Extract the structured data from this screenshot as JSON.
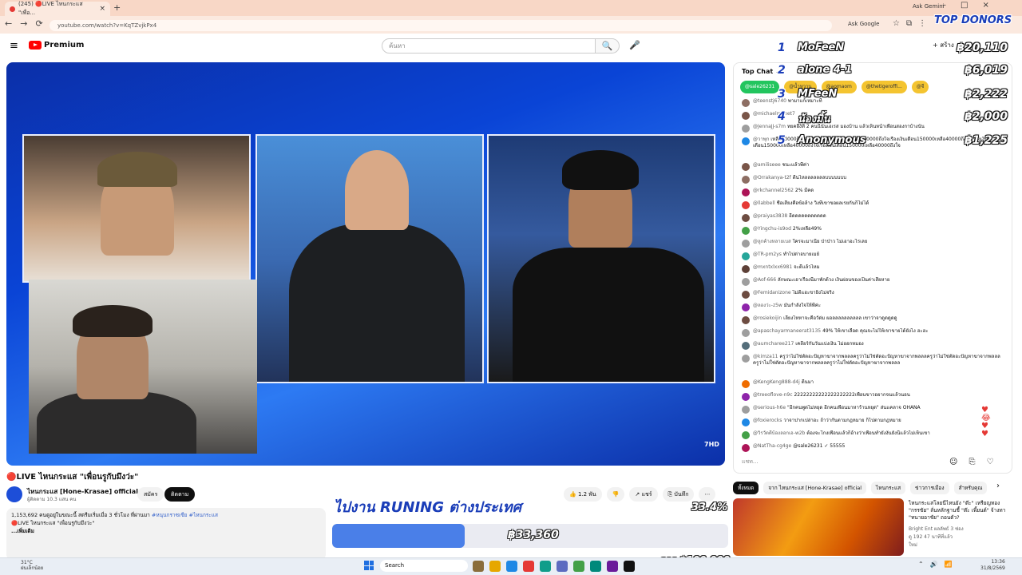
{
  "browser": {
    "tab_title": "(245) 🔴LIVE ไหนกระแส \"เพื่อ...",
    "tab_close": "×",
    "new_tab": "+",
    "ask_gemini": "Ask Gemini",
    "window_controls": [
      "–",
      "□",
      "×"
    ],
    "nav": [
      "←",
      "→",
      "⟳"
    ],
    "url": "youtube.com/watch?v=KqTZvjkPx4",
    "ask_google": "Ask Google",
    "icons": [
      "☆",
      "⧉",
      "⋮"
    ]
  },
  "youtube": {
    "menu_icon": "≡",
    "logo_text": "Premium",
    "search_placeholder": "ค้นหา",
    "search_icon": "🔍",
    "mic_icon": "🎤",
    "create_label": "+ สร้าง",
    "channel_logo": "7HD"
  },
  "video": {
    "title": "🔴LIVE ไหนกระแส \"เพื่อนรูกับมึงว่ะ\"",
    "channel_name": "ไหนกระแส [Hone-Krasae] official ✔",
    "channel_subs": "ผู้ติดตาม 10.3 แสน คน",
    "join_label": "สมัคร",
    "subscribe_label": "ติดตาม",
    "actions": [
      "👍 1.2 พัน",
      "👎",
      "↗ แชร์",
      "⎘ บันทึก",
      "⋯"
    ],
    "desc_line1": "1,153,692 คนดูอยู่ในขณะนี้  สตรีมเริ่มเมื่อ 3 ชั่วโมง ที่ผ่านมา",
    "desc_hashtags": "#หนุนกราซเซีย #ไหนกระแส",
    "desc_line2": "🔴LIVE ไหนกระแส \"เพื่อนรูกับมึงว่ะ\"",
    "desc_more": "...เพิ่มเติม"
  },
  "goal": {
    "title": "ไปงาน RUNING ต่างประเทศ",
    "percent": "33.4%",
    "percent_value": 0.334,
    "current": "฿33,360",
    "total": "จาก ฿100,000"
  },
  "donors": {
    "title": "TOP DONORS",
    "list": [
      {
        "rank": "1",
        "name": "MoFeeN",
        "amount": "฿20,110"
      },
      {
        "rank": "2",
        "name": "alone 4-1",
        "amount": "฿6,019"
      },
      {
        "rank": "3",
        "name": "MFeeN",
        "amount": "฿2,222"
      },
      {
        "rank": "4",
        "name": "น้องมิ้น",
        "amount": "฿2,000"
      },
      {
        "rank": "5",
        "name": "Anonymous",
        "amount": "฿1,225"
      }
    ]
  },
  "chat": {
    "header": "Top Chat ⌄",
    "pins": [
      {
        "label": "@sale26231",
        "style": "green"
      },
      {
        "label": "@น้ำหวาน",
        "style": "yellow"
      },
      {
        "label": "@aomaom",
        "style": "yellow"
      },
      {
        "label": "@thetigeroffi...",
        "style": "yellow"
      },
      {
        "label": "@จี",
        "style": "yellow"
      }
    ],
    "messages": [
      {
        "author": "@teenstj6740",
        "text": "พามาแก้เหมาะที่",
        "color": "#8d6e63"
      },
      {
        "author": "@michaelmonet7",
        "text": "",
        "color": "#795548"
      },
      {
        "author": "@JennaJJ-s7m",
        "text": "ทยคอื่ง้ที่ 2 คนนี้นั่นเอเรส มองบ้าน แล้วเห็นหน้าเพื่อนสองกาบ้างนั่น",
        "color": "#9e9e9e"
      },
      {
        "author": "@วาพุก",
        "text": "เหลือ40000ถึงใจเรื่องเงินเดือน150000เหลือ40000ถึงใจเรื่องเงินเดือน150000เหลือ40000ถึงใจเรื่องเงินเดือน150000เหลือ40000ถึงใจเรื่องเงินเดือน150000เหลือ40000ถึงใจ",
        "color": "#1e88e5",
        "tall": true
      },
      {
        "author": "@amiliseee",
        "text": "ชนะแล้วพี่ค่า",
        "color": "#795548"
      },
      {
        "author": "@Orrakanya-t2f",
        "text": "ดีนไหลลลลลลลบบบบบบบ",
        "color": "#8d6e63"
      },
      {
        "author": "@rkchannel2562",
        "text": "2% มีคด",
        "color": "#ad1457"
      },
      {
        "author": "@llabbell",
        "text": "ชื่อเสียงคือข้อล้าง วิ่งที่เขาขอผลเรยกันก็ไม่ได้",
        "color": "#e53935"
      },
      {
        "author": "@praiyas3838",
        "text": "อีดดดดดดดดดดด",
        "color": "#6d4c41"
      },
      {
        "author": "@Yingchu-is9od",
        "text": "2%เหลือ49%",
        "color": "#43a047"
      },
      {
        "author": "@ลูกค้างหลายเบส",
        "text": "ใครจะมาเนี่ย ป่าป่าว ไม่เอาอะไรเลย",
        "color": "#9e9e9e"
      },
      {
        "author": "@TR-pm2ys",
        "text": "ทำไปด่าอบายเมย์",
        "color": "#26a69a"
      },
      {
        "author": "@mxntxlxx6981",
        "text": "จะดีแล้วไหม",
        "color": "#5d4037"
      },
      {
        "author": "@Aof-666",
        "text": "ลักษณะเอาเรื่องนี้มาพักด้วง เงินผ่อนของเป็นค่าเสียหาย",
        "color": "#9e9e9e"
      },
      {
        "author": "@Femidanizone",
        "text": "ไม่ดีแฮะขายิ่งไม่จริง",
        "color": "#6d4c41"
      },
      {
        "author": "@ลองว่ะ-z5w",
        "text": "มันกำลังใจให้พี่ค่ะ",
        "color": "#8e24aa"
      },
      {
        "author": "@rosiekoijin",
        "text": "เลี้ยงไหหาจะคือวัด่ม ผอลลลลลลลลลล เขาว่าจาดูดดูดดู",
        "color": "#6d4c41"
      },
      {
        "author": "@apaschayarmaneerat3135",
        "text": "49% ให้เขาเลือด คุณจะไม่ให้เขาขายได้ยังไง ฮะฮะ",
        "color": "#9e9e9e"
      },
      {
        "author": "@aumcharee217",
        "text": "เคลียร์กันวันแบ่งเงิน ไม่ออกหมอง",
        "color": "#546e7a"
      },
      {
        "author": "@kimza11",
        "text": "ครูว่าไม่ใช่ตัดอะปัญหาฆาจากพลลลครูว่าไม่ใช่ตัดอะปัญหาฆาจากพลลลครูว่าไม่ใช่ตัดอะปัญหาฆาจากพลลลครูว่าไม่ใช่ตัดอะปัญหาฆาจากพลลลครูว่าไม่ใช่ตัดอะปัญหาฆาจากพลลล",
        "color": "#9e9e9e",
        "tall": true
      },
      {
        "author": "@KengKeng888-d4j",
        "text": "ดีนมา",
        "color": "#ef6c00"
      },
      {
        "author": "@treeoflove-n9c",
        "text": "22222222222222222222เพื่อนขาวอยากจนแล้วนอน",
        "color": "#8e24aa"
      },
      {
        "author": "@serious-h6e",
        "text": "\"อีกคนพูดไม่หยุด อีกคนเพื่อนมาหาร้านหยุด\" ส่นแคลาจ OHANA",
        "color": "#9e9e9e"
      },
      {
        "author": "@foxierocks",
        "text": "วาจาปากเปล่าอะ ถ้าว่ากันตามกฎหมาย ก็ไปตามกฎหมาย",
        "color": "#1e88e5"
      },
      {
        "author": "@วิรวัตตีบ้องลอกเอ-w2b",
        "text": "ต้องจะโกงเพื่อนแล้วก็อ้างว่าเพื่อนทำยังงั้นยังนี้แล้วไม่เห็นเขา",
        "color": "#43a047"
      },
      {
        "author": "@NatTha-cg4ge",
        "text": "@sale26231 ✓  55555",
        "color": "#ad1457"
      }
    ],
    "input_placeholder": "แชท...",
    "input_icons": [
      "☺",
      "⎘",
      "♡"
    ],
    "hearts": "♥\n😂\n♥\n♥"
  },
  "rail": {
    "chips": [
      "ทั้งหมด",
      "จาก ไหนกระแส [Hone-Krasae] official",
      "ไหนกระแส",
      "ข่าวการเมือง",
      "สำหรับคุณ"
    ],
    "chips_next": "›",
    "rec_title": "ไหนกระแสโลยนีไหนยัง \"ต๊ะ\" เหรียญทอง \"กรรชัย\" ลั่นหลักฐานชี้ \"ต๊ะ เพี้ยนต์\" จ้างทา \"ทนายอาชัย\" ถอนตัว?",
    "rec_channel": "Bright Ent ผลลัพธ์ 3 ซ่อง",
    "rec_stats": "ดู 192  47 นาทีที่แล้ว",
    "rec_badge": "ใหม่"
  },
  "taskbar": {
    "weather_temp": "31°C",
    "weather_desc": "ฝนเล็กน้อย",
    "search": "Search",
    "tray": [
      "⌃",
      "🔊",
      "📶"
    ],
    "time": "13:36",
    "date": "31/8/2569"
  },
  "colors": {
    "accent_blue": "#1a3db8",
    "yt_red": "#ff0000",
    "goal_fill": "#4a7fe8"
  }
}
